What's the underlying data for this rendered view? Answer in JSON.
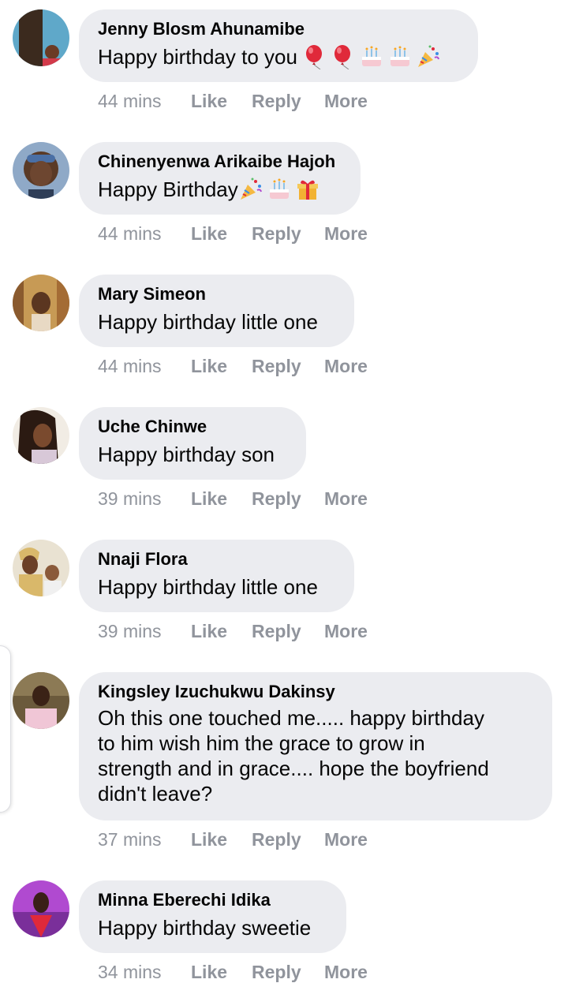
{
  "comments": [
    {
      "author": "Jenny Blosm Ahunamibe",
      "text": "Happy birthday to you",
      "emojis": [
        "balloon-icon",
        "balloon-icon",
        "birthday-cake-icon",
        "birthday-cake-icon",
        "party-popper-icon"
      ],
      "time": "44 mins",
      "like": "Like",
      "reply": "Reply",
      "more": "More",
      "avatar_color": "#5fa8c9"
    },
    {
      "author": "Chinenyenwa Arikaibe Hajoh",
      "text": "Happy Birthday",
      "emojis": [
        "party-popper-icon",
        "birthday-cake-icon",
        "wrapped-gift-icon"
      ],
      "time": "44 mins",
      "like": "Like",
      "reply": "Reply",
      "more": "More",
      "avatar_color": "#4a6fa5"
    },
    {
      "author": "Mary Simeon",
      "text": "Happy birthday little one",
      "emojis": [],
      "time": "44 mins",
      "like": "Like",
      "reply": "Reply",
      "more": "More",
      "avatar_color": "#c79a55"
    },
    {
      "author": "Uche Chinwe",
      "text": "Happy birthday son",
      "emojis": [],
      "time": "39 mins",
      "like": "Like",
      "reply": "Reply",
      "more": "More",
      "avatar_color": "#7a4a2e"
    },
    {
      "author": "Nnaji Flora",
      "text": "Happy birthday little one",
      "emojis": [],
      "time": "39 mins",
      "like": "Like",
      "reply": "Reply",
      "more": "More",
      "avatar_color": "#d9b86a"
    },
    {
      "author": "Kingsley Izuchukwu Dakinsy",
      "text_lines": [
        "Oh this one touched me..... happy birthday",
        "to him wish him the grace to grow in",
        "strength and in grace.... hope the boyfriend",
        "didn't leave?"
      ],
      "time": "37 mins",
      "like": "Like",
      "reply": "Reply",
      "more": "More",
      "avatar_color": "#6b5a3c"
    },
    {
      "author": "Minna Eberechi Idika",
      "text": "Happy birthday sweetie",
      "emojis": [],
      "time": "34 mins",
      "like": "Like",
      "reply": "Reply",
      "more": "More",
      "avatar_color": "#b04ad0"
    }
  ],
  "colors": {
    "bubble": "#ebecf0",
    "meta": "#90949c"
  }
}
